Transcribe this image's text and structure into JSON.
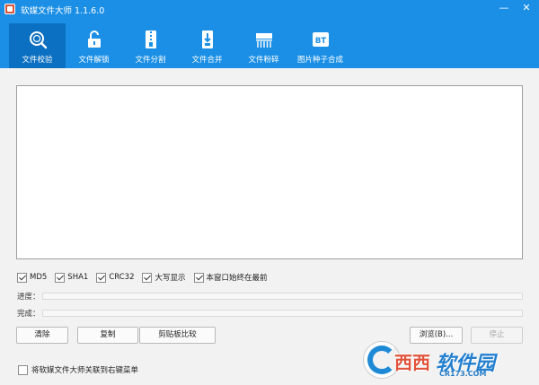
{
  "window": {
    "title": "软媒文件大师 1.1.6.0"
  },
  "window_controls": {
    "minimize": "—",
    "close": "✕"
  },
  "tabs": [
    {
      "label": "文件校验",
      "icon": "magnifier-check-icon",
      "active": true
    },
    {
      "label": "文件解锁",
      "icon": "unlock-icon",
      "active": false
    },
    {
      "label": "文件分割",
      "icon": "zip-split-icon",
      "active": false
    },
    {
      "label": "文件合并",
      "icon": "merge-file-icon",
      "active": false
    },
    {
      "label": "文件粉碎",
      "icon": "shredder-icon",
      "active": false
    },
    {
      "label": "图片种子合成",
      "icon": "bt-icon",
      "active": false
    }
  ],
  "options": [
    {
      "label": "MD5",
      "checked": true
    },
    {
      "label": "SHA1",
      "checked": true
    },
    {
      "label": "CRC32",
      "checked": true
    },
    {
      "label": "大写显示",
      "checked": true
    },
    {
      "label": "本窗口始终在最前",
      "checked": true
    }
  ],
  "progress": {
    "label": "进度：",
    "value": 0
  },
  "complete": {
    "label": "完成：",
    "value": 0
  },
  "buttons": {
    "clear": "清除",
    "copy": "复制",
    "clipboard_compare": "剪贴板比较",
    "browse": "浏览(B)...",
    "stop": "停止"
  },
  "associate": {
    "label": "将软媒文件大师关联到右键菜单",
    "checked": false
  },
  "watermark": {
    "brand": "西西",
    "brand2": "软件园",
    "url": "CR173.COM"
  },
  "colors": {
    "header": "#1a8fe5",
    "active_tab": "#0c70c2"
  }
}
